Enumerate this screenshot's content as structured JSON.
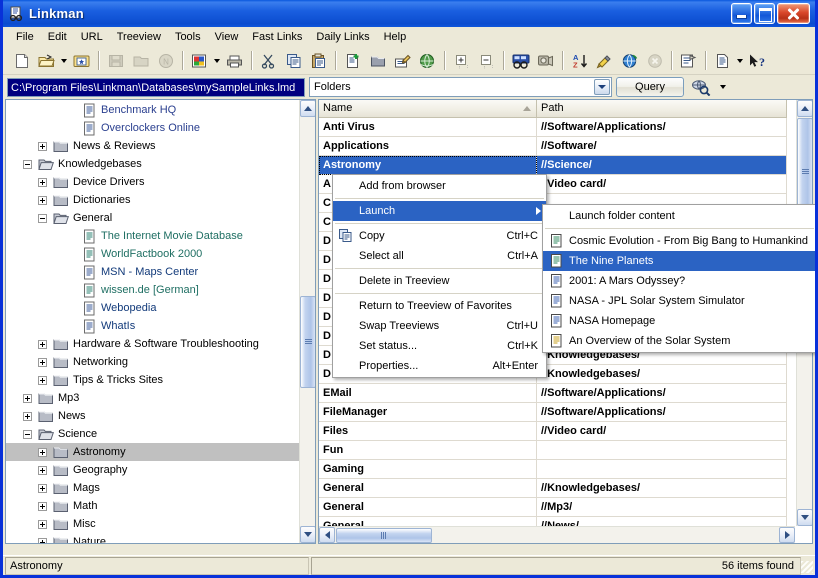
{
  "window": {
    "title": "Linkman",
    "icon": "linkman-icon",
    "buttons": {
      "minimize": "minimize",
      "maximize": "maximize",
      "close": "close"
    }
  },
  "menubar": {
    "items": [
      {
        "label": "File"
      },
      {
        "label": "Edit"
      },
      {
        "label": "URL"
      },
      {
        "label": "Treeview"
      },
      {
        "label": "Tools"
      },
      {
        "label": "View"
      },
      {
        "label": "Fast Links"
      },
      {
        "label": "Daily Links"
      },
      {
        "label": "Help"
      }
    ]
  },
  "toolbar": {
    "items": [
      {
        "name": "new-document-icon"
      },
      {
        "name": "open-folder-icon",
        "dropdown": true
      },
      {
        "name": "new-folder-star-icon"
      },
      {
        "sep": true
      },
      {
        "name": "save-icon",
        "disabled": true
      },
      {
        "name": "folder-icon",
        "disabled": true
      },
      {
        "name": "net-icon",
        "disabled": true
      },
      {
        "sep": true
      },
      {
        "name": "import-icon",
        "dropdown": true
      },
      {
        "name": "print-icon"
      },
      {
        "sep": true
      },
      {
        "name": "cut-icon"
      },
      {
        "name": "copy-icon"
      },
      {
        "name": "paste-icon"
      },
      {
        "sep": true
      },
      {
        "name": "new-link-icon"
      },
      {
        "name": "new-folder-icon"
      },
      {
        "name": "edit-link-icon"
      },
      {
        "name": "browse-globe-icon"
      },
      {
        "sep": true
      },
      {
        "name": "expand-all-icon"
      },
      {
        "name": "collapse-all-icon"
      },
      {
        "sep": true
      },
      {
        "name": "find-duplicates-icon"
      },
      {
        "name": "check-links-icon"
      },
      {
        "sep": true
      },
      {
        "name": "sort-az-icon"
      },
      {
        "name": "filter-icon"
      },
      {
        "name": "globe-sync-icon"
      },
      {
        "name": "stop-icon",
        "disabled": true
      },
      {
        "sep": true
      },
      {
        "name": "properties-icon"
      },
      {
        "sep": true
      },
      {
        "name": "report-icon",
        "dropdown": true
      },
      {
        "name": "help-pointer-icon"
      }
    ]
  },
  "pathbar": {
    "database_path": "C:\\Program Files\\Linkman\\Databases\\mySampleLinks.lmd",
    "view_select_value": "Folders",
    "query_button": "Query",
    "find_icon": "find-globe-icon"
  },
  "treeview": {
    "items": [
      {
        "label": "Benchmark HQ",
        "indent": 4,
        "toggle": "none",
        "icon": "document-icon",
        "color": "link-blue"
      },
      {
        "label": "Overclockers Online",
        "indent": 4,
        "toggle": "none",
        "icon": "document-icon",
        "color": "link-blue"
      },
      {
        "label": "News & Reviews",
        "indent": 2,
        "toggle": "plus",
        "icon": "folder-icon",
        "color": "plain"
      },
      {
        "label": "Knowledgebases",
        "indent": 1,
        "toggle": "minus",
        "icon": "folder-open-icon",
        "color": "plain"
      },
      {
        "label": "Device Drivers",
        "indent": 2,
        "toggle": "plus",
        "icon": "folder-icon",
        "color": "plain"
      },
      {
        "label": "Dictionaries",
        "indent": 2,
        "toggle": "plus",
        "icon": "folder-icon",
        "color": "plain"
      },
      {
        "label": "General",
        "indent": 2,
        "toggle": "minus",
        "icon": "folder-open-icon",
        "color": "plain"
      },
      {
        "label": "The Internet Movie Database",
        "indent": 4,
        "toggle": "none",
        "icon": "document-icon",
        "color": "link-teal"
      },
      {
        "label": "WorldFactbook 2000",
        "indent": 4,
        "toggle": "none",
        "icon": "document-icon",
        "color": "link-teal"
      },
      {
        "label": "MSN - Maps Center",
        "indent": 4,
        "toggle": "none",
        "icon": "document-icon",
        "color": "link-navy"
      },
      {
        "label": "wissen.de [German]",
        "indent": 4,
        "toggle": "none",
        "icon": "document-icon",
        "color": "link-teal"
      },
      {
        "label": "Webopedia",
        "indent": 4,
        "toggle": "none",
        "icon": "document-icon",
        "color": "link-navy"
      },
      {
        "label": "WhatIs",
        "indent": 4,
        "toggle": "none",
        "icon": "document-icon",
        "color": "link-navy"
      },
      {
        "label": "Hardware & Software Troubleshooting",
        "indent": 2,
        "toggle": "plus",
        "icon": "folder-icon",
        "color": "plain"
      },
      {
        "label": "Networking",
        "indent": 2,
        "toggle": "plus",
        "icon": "folder-icon",
        "color": "plain"
      },
      {
        "label": "Tips & Tricks Sites",
        "indent": 2,
        "toggle": "plus",
        "icon": "folder-icon",
        "color": "plain"
      },
      {
        "label": "Mp3",
        "indent": 1,
        "toggle": "plus",
        "icon": "folder-icon",
        "color": "plain"
      },
      {
        "label": "News",
        "indent": 1,
        "toggle": "plus",
        "icon": "folder-icon",
        "color": "plain"
      },
      {
        "label": "Science",
        "indent": 1,
        "toggle": "minus",
        "icon": "folder-open-icon",
        "color": "plain"
      },
      {
        "label": "Astronomy",
        "indent": 2,
        "toggle": "plus",
        "icon": "folder-icon",
        "color": "plain",
        "selected": true
      },
      {
        "label": "Geography",
        "indent": 2,
        "toggle": "plus",
        "icon": "folder-icon",
        "color": "plain"
      },
      {
        "label": "Mags",
        "indent": 2,
        "toggle": "plus",
        "icon": "folder-icon",
        "color": "plain"
      },
      {
        "label": "Math",
        "indent": 2,
        "toggle": "plus",
        "icon": "folder-icon",
        "color": "plain"
      },
      {
        "label": "Misc",
        "indent": 2,
        "toggle": "plus",
        "icon": "folder-icon",
        "color": "plain"
      },
      {
        "label": "Nature",
        "indent": 2,
        "toggle": "plus",
        "icon": "folder-icon",
        "color": "plain"
      }
    ]
  },
  "listview": {
    "columns": [
      {
        "label": "Name",
        "sorted": true
      },
      {
        "label": "Path"
      }
    ],
    "rows": [
      {
        "name": "Anti Virus",
        "path": "//Software/Applications/"
      },
      {
        "name": "Applications",
        "path": "//Software/"
      },
      {
        "name": "Astronomy",
        "path": "//Science/",
        "selected": true
      },
      {
        "name": "A",
        "path": "//Video card/"
      },
      {
        "name": "C",
        "path": ""
      },
      {
        "name": "C",
        "path": ""
      },
      {
        "name": "D",
        "path": ""
      },
      {
        "name": "D",
        "path": ""
      },
      {
        "name": "D",
        "path": ""
      },
      {
        "name": "D",
        "path": ""
      },
      {
        "name": "D",
        "path": ""
      },
      {
        "name": "D",
        "path": ""
      },
      {
        "name": "D",
        "path": "//Knowledgebases/"
      },
      {
        "name": "D",
        "path": "//Knowledgebases/"
      },
      {
        "name": "EMail",
        "path": "//Software/Applications/"
      },
      {
        "name": "FileManager",
        "path": "//Software/Applications/"
      },
      {
        "name": "Files",
        "path": "//Video card/"
      },
      {
        "name": "Fun",
        "path": ""
      },
      {
        "name": "Gaming",
        "path": ""
      },
      {
        "name": "General",
        "path": "//Knowledgebases/"
      },
      {
        "name": "General",
        "path": "//Mp3/"
      },
      {
        "name": "General",
        "path": "//News/"
      }
    ]
  },
  "context_menu": {
    "items": [
      {
        "label": "Add from browser",
        "accel": "",
        "icon": "",
        "type": "item"
      },
      {
        "type": "separator"
      },
      {
        "label": "Launch",
        "accel": "",
        "icon": "",
        "type": "item",
        "selected": true,
        "submenu": true
      },
      {
        "type": "separator"
      },
      {
        "label": "Copy",
        "accel": "Ctrl+C",
        "icon": "copy-icon",
        "type": "item"
      },
      {
        "label": "Select all",
        "accel": "Ctrl+A",
        "icon": "",
        "type": "item"
      },
      {
        "type": "separator"
      },
      {
        "label": "Delete in Treeview",
        "accel": "",
        "icon": "",
        "type": "item"
      },
      {
        "type": "separator"
      },
      {
        "label": "Return to Treeview of Favorites",
        "accel": "",
        "icon": "",
        "type": "item"
      },
      {
        "label": "Swap Treeviews",
        "accel": "Ctrl+U",
        "icon": "",
        "type": "item"
      },
      {
        "label": "Set status...",
        "accel": "Ctrl+K",
        "icon": "",
        "type": "item"
      },
      {
        "label": "Properties...",
        "accel": "Alt+Enter",
        "icon": "",
        "type": "item"
      }
    ]
  },
  "submenu": {
    "items": [
      {
        "label": "Launch folder content",
        "type": "item",
        "icon": ""
      },
      {
        "type": "separator"
      },
      {
        "label": "Cosmic Evolution - From Big Bang to Humankind",
        "type": "item",
        "icon": "document-green-icon"
      },
      {
        "label": "The Nine Planets",
        "type": "item",
        "icon": "document-green-icon",
        "selected": true
      },
      {
        "label": "2001: A Mars Odyssey?",
        "type": "item",
        "icon": "document-blue-icon"
      },
      {
        "label": "NASA - JPL Solar System Simulator",
        "type": "item",
        "icon": "document-blue-icon"
      },
      {
        "label": "NASA Homepage",
        "type": "item",
        "icon": "document-blue-icon"
      },
      {
        "label": "An Overview of the Solar System",
        "type": "item",
        "icon": "document-yellow-icon"
      }
    ]
  },
  "statusbar": {
    "left": "Astronomy",
    "right": "56 items found"
  },
  "colors": {
    "title_blue": "#0a51d6",
    "face": "#ece9d8",
    "selection_blue": "#2b63c3",
    "path_field_bg": "#000080",
    "tree_selection": "#c0c0c0"
  }
}
